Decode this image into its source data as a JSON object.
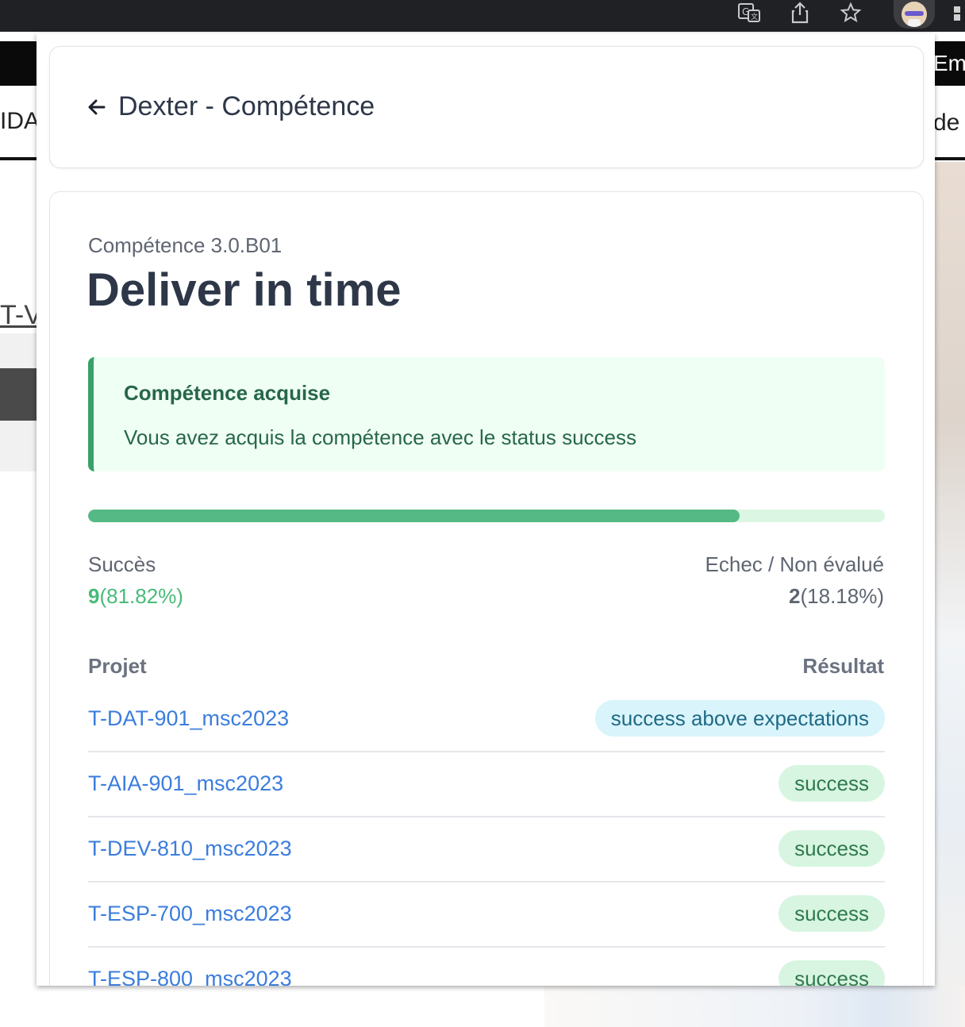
{
  "browser": {
    "toolbar_icons": [
      "translate-icon",
      "share-icon",
      "bookmark-star-icon",
      "profile-avatar",
      "extensions-icon"
    ]
  },
  "background_page": {
    "right_header_fragment": "Em",
    "left_nav_fragment": "IDA",
    "right_nav_fragment": "de",
    "left_link_fragment": "T-V"
  },
  "popup": {
    "header": {
      "back_icon": "arrow-left-icon",
      "title": "Dexter - Compétence"
    },
    "competence": {
      "code": "Compétence 3.0.B01",
      "title": "Deliver in time"
    },
    "alert": {
      "title": "Compétence acquise",
      "message": "Vous avez acquis la compétence avec le status success",
      "color": "#38a169"
    },
    "progress": {
      "success_percent": 81.82
    },
    "stats": {
      "success_label": "Succès",
      "success_count": "9",
      "success_pct": "(81.82%)",
      "fail_label": "Echec / Non évalué",
      "fail_count": "2",
      "fail_pct": "(18.18%)"
    },
    "table": {
      "col_project": "Projet",
      "col_result": "Résultat",
      "rows": [
        {
          "project": "T-DAT-901_msc2023",
          "result": "success above expectations",
          "kind": "above"
        },
        {
          "project": "T-AIA-901_msc2023",
          "result": "success",
          "kind": "success"
        },
        {
          "project": "T-DEV-810_msc2023",
          "result": "success",
          "kind": "success"
        },
        {
          "project": "T-ESP-700_msc2023",
          "result": "success",
          "kind": "success"
        },
        {
          "project": "T-ESP-800_msc2023",
          "result": "success",
          "kind": "success"
        }
      ]
    }
  }
}
